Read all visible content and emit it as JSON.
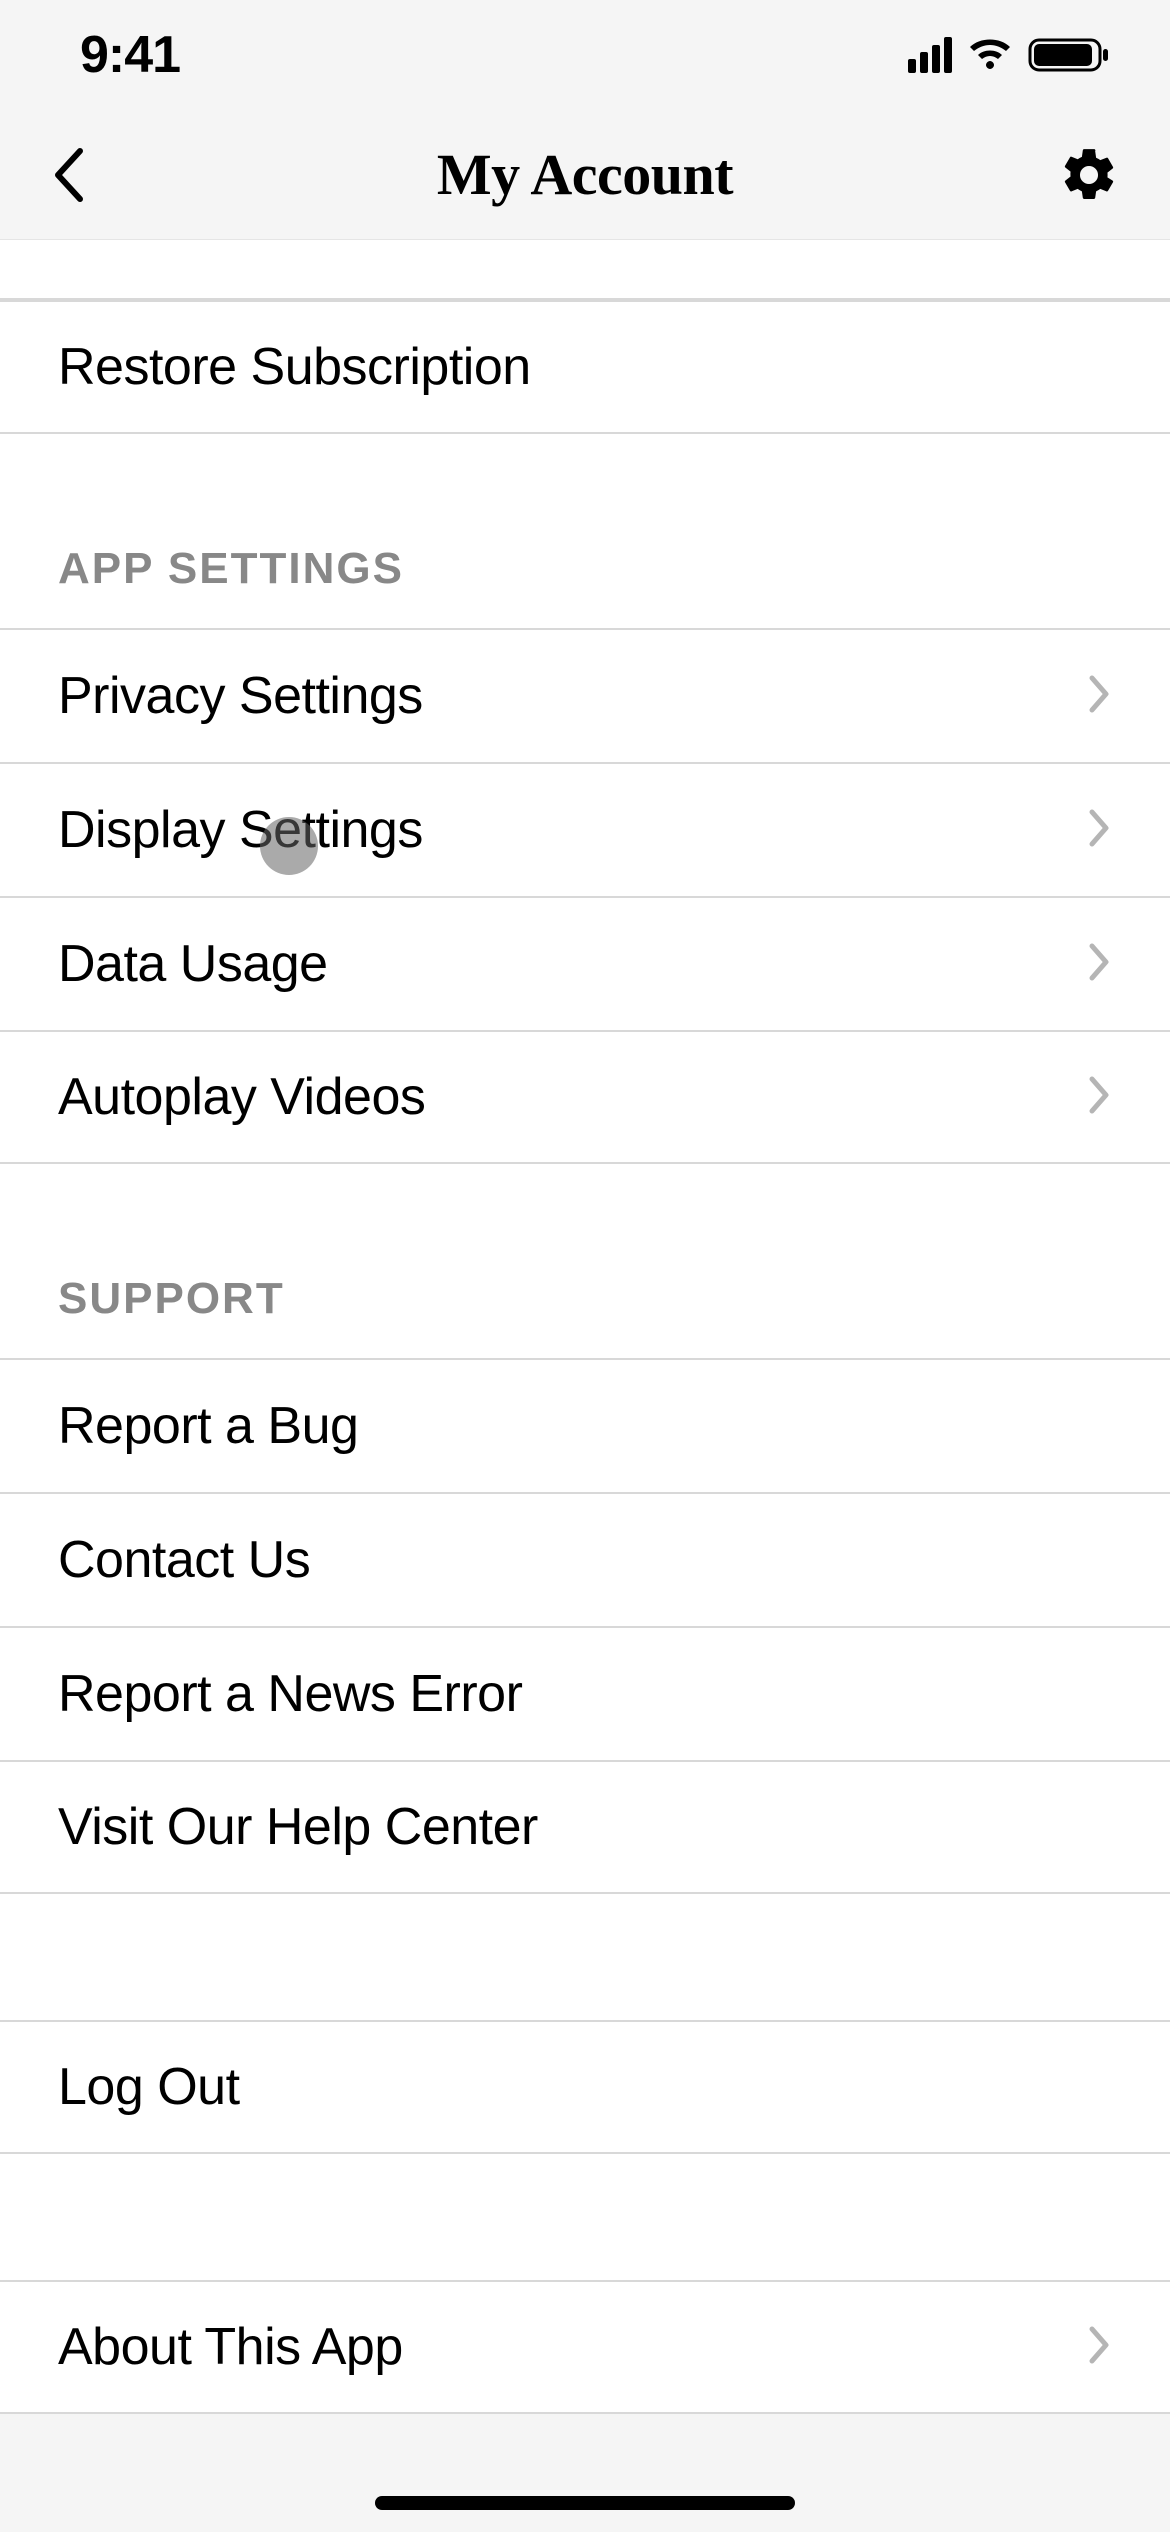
{
  "status": {
    "time": "9:41"
  },
  "header": {
    "title": "My Account"
  },
  "top_rows": {
    "restore": "Restore Subscription"
  },
  "sections": {
    "app_settings": {
      "header": "APP SETTINGS",
      "rows": {
        "privacy": "Privacy Settings",
        "display": "Display Settings",
        "data_usage": "Data Usage",
        "autoplay": "Autoplay Videos"
      }
    },
    "support": {
      "header": "SUPPORT",
      "rows": {
        "report_bug": "Report a Bug",
        "contact_us": "Contact Us",
        "report_news_error": "Report a News Error",
        "help_center": "Visit Our Help Center"
      }
    }
  },
  "logout": "Log Out",
  "about": "About This App"
}
